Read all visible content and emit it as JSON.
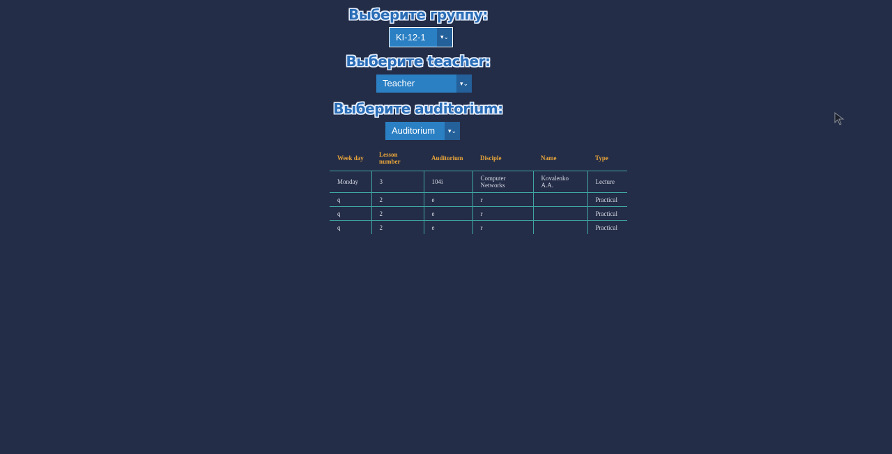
{
  "headings": {
    "group": "Выберите группу:",
    "teacher": "Выберите teacher:",
    "auditorium": "Выберите auditorium:"
  },
  "selects": {
    "group": "KI-12-1",
    "teacher": "Teacher",
    "auditorium": "Auditorium"
  },
  "table": {
    "headers": [
      "Week day",
      "Lesson number",
      "Auditorium",
      "Disciple",
      "Name",
      "Type"
    ],
    "rows": [
      [
        "Monday",
        "3",
        "104i",
        "Computer Networks",
        "Kovalenko A.A.",
        "Lecture"
      ],
      [
        "q",
        "2",
        "e",
        "r",
        "",
        "Practical"
      ],
      [
        "q",
        "2",
        "e",
        "r",
        "",
        "Practical"
      ],
      [
        "q",
        "2",
        "e",
        "r",
        "",
        "Practical"
      ]
    ]
  },
  "colors": {
    "background": "#242d47",
    "select": "#2b80c4",
    "header_text": "#e8a53a",
    "grid": "#3fa7a3"
  },
  "icons": [
    "chevron-down-icon",
    "mouse-cursor-icon"
  ]
}
